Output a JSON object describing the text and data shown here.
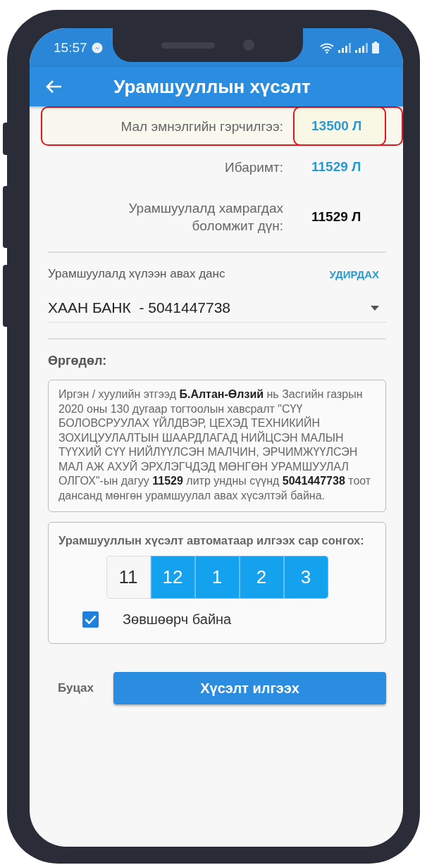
{
  "status_bar": {
    "time": "15:57"
  },
  "app_bar": {
    "title": "Урамшууллын хүсэлт"
  },
  "summary_rows": [
    {
      "label": "Мал эмнэлгийн гэрчилгээ:",
      "value": "13500 Л",
      "kind": "link",
      "highlighted": true
    },
    {
      "label": "Ибаримт:",
      "value": "11529 Л",
      "kind": "link",
      "highlighted": false
    },
    {
      "label": "Урамшуулалд хамрагдах боломжит дүн:",
      "value": "11529 Л",
      "kind": "total",
      "highlighted": false
    }
  ],
  "account": {
    "label": "Урамшуулалд хүлээн авах данс",
    "action": "УДИРДАХ",
    "value": "ХААН БАНК  - 5041447738"
  },
  "application": {
    "heading": "Өргөдөл:",
    "text": "Иргэн / хуулийн этгээд **Б.Алтан-Өлзий** нь Засгийн газрын 2020 оны 130 дугаар тогтоолын хавсралт \"СҮҮ БОЛОВСРУУЛАХ ҮЙЛДВЭР, ЦЕХЭД ТЕХНИКИЙН ЗОХИЦУУЛАЛТЫН ШААРДЛАГАД НИЙЦСЭН МАЛЫН ТҮҮХИЙ СҮҮ НИЙЛҮҮЛСЭН МАЛЧИН, ЭРЧИМЖҮҮЛСЭН МАЛ АЖ АХУЙ ЭРХЛЭГЧДЭД МӨНГӨН УРАМШУУЛАЛ ОЛГОХ\"-ын дагуу **11529** литр ундны сүүнд **5041447738** тоот дансанд мөнгөн урамшуулал авах хүсэлтэй байна."
  },
  "auto_send": {
    "heading": "Урамшууллын хүсэлт автоматаар илгээх сар сонгох:",
    "months": [
      {
        "label": "11",
        "selected": false
      },
      {
        "label": "12",
        "selected": true
      },
      {
        "label": "1",
        "selected": true
      },
      {
        "label": "2",
        "selected": true
      },
      {
        "label": "3",
        "selected": true
      }
    ],
    "consent": {
      "label": "Зөвшөөрч байна",
      "checked": true
    }
  },
  "buttons": {
    "back": "Буцах",
    "submit": "Хүсэлт илгээх"
  }
}
